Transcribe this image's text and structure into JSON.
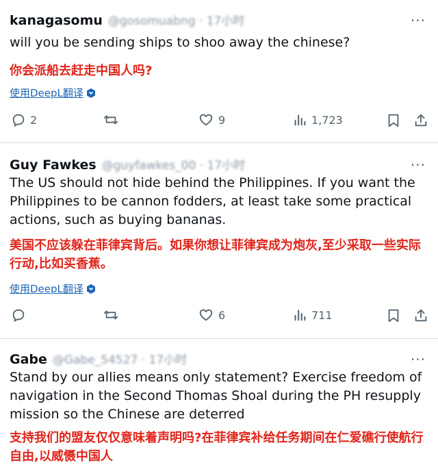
{
  "posts": [
    {
      "name": "kanagasomu",
      "handle": "@gosomuabng · 17小时",
      "text_en": "will you be sending ships to shoo away the chinese?",
      "text_cn": "你会派船去赶走中国人吗?",
      "translate_label": "使用DeepL翻译",
      "replies": "2",
      "reposts": "",
      "likes": "9",
      "views": "1,723"
    },
    {
      "name": "Guy Fawkes",
      "handle": "@guyfawkes_00 · 17小时",
      "text_en": "The US should not hide behind the Philippines. If you want the Philippines to be cannon fodders, at least take some practical actions, such as buying bananas.",
      "text_cn": "美国不应该躲在菲律宾背后。如果你想让菲律宾成为炮灰,至少采取一些实际行动,比如买香蕉。",
      "translate_label": "使用DeepL翻译",
      "replies": "",
      "reposts": "",
      "likes": "6",
      "views": "711"
    },
    {
      "name": "Gabe",
      "handle": "@Gabe_54527 · 17小时",
      "text_en": "Stand by our allies means only statement? Exercise freedom of navigation in the Second Thomas Shoal during the PH resupply mission so the Chinese are deterred",
      "text_cn": "支持我们的盟友仅仅意味着声明吗?在菲律宾补给任务期间在仁爱礁行使航行自由,以威慑中国人",
      "translate_label": "",
      "replies": "",
      "reposts": "",
      "likes": "",
      "views": ""
    }
  ],
  "more_label": "···",
  "icons": {
    "reply": "reply-icon",
    "repost": "repost-icon",
    "like": "like-icon",
    "views": "views-icon",
    "bookmark": "bookmark-icon",
    "share": "share-icon",
    "translate_badge": "translate-badge-icon"
  },
  "colors": {
    "text": "#0f1419",
    "secondary": "#536471",
    "chinese_text": "#e0251b",
    "translate_link": "#1d66b5",
    "divider": "#d9dde1"
  }
}
